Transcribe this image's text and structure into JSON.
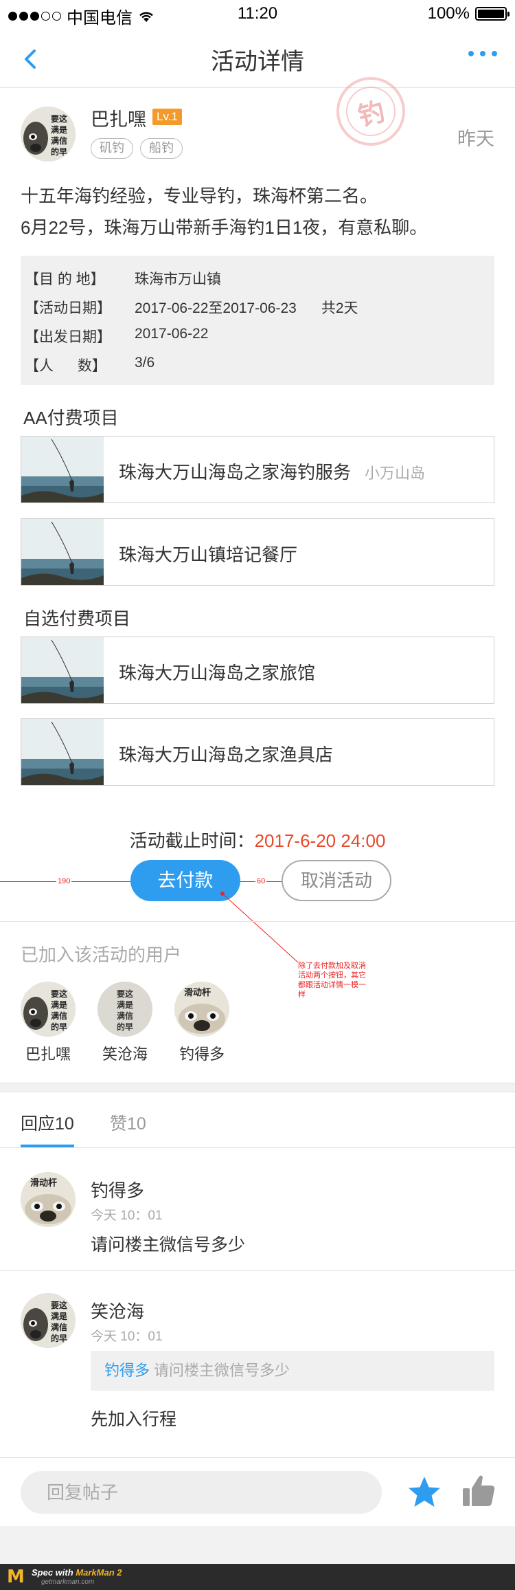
{
  "status_bar": {
    "carrier": "中国电信",
    "time": "11:20",
    "battery": "100%"
  },
  "nav": {
    "title": "活动详情",
    "back_icon": "chevron-left-icon",
    "more_icon": "more-dots-icon"
  },
  "post": {
    "author": "巴扎嘿",
    "level": "Lv.1",
    "tags": [
      "矶钓",
      "船钓"
    ],
    "time": "昨天",
    "seal_text": "钓",
    "avatar_text": "要这满是信的早",
    "text_lines": [
      "十五年海钓经验，专业导钓，珠海杯第二名。",
      "6月22号，珠海万山带新手海钓1日1夜，有意私聊。"
    ]
  },
  "info": {
    "destination_label": "【目 的 地】",
    "destination": "珠海市万山镇",
    "activity_date_label": "【活动日期】",
    "activity_date": "2017-06-22至2017-06-23",
    "activity_days": "共2天",
    "depart_date_label": "【出发日期】",
    "depart_date": "2017-06-22",
    "people_label": "【人      数】",
    "people": "3/6"
  },
  "aa_section": {
    "title": "AA付费项目",
    "items": [
      {
        "name": "珠海大万山海岛之家海钓服务",
        "sub": "小万山岛"
      },
      {
        "name": "珠海大万山镇培记餐厅",
        "sub": ""
      }
    ]
  },
  "optional_section": {
    "title": "自选付费项目",
    "items": [
      {
        "name": "珠海大万山海岛之家旅馆"
      },
      {
        "name": "珠海大万山海岛之家渔具店"
      }
    ]
  },
  "deadline": {
    "label": "活动截止时间：",
    "value": "2017-6-20 24:00"
  },
  "actions": {
    "pay_label": "去付款",
    "cancel_label": "取消活动"
  },
  "spec": {
    "left_gap": "190",
    "button_gap": "60",
    "note": "除了去付款加及取消活动两个按钮，其它都跟活动详情一模一样"
  },
  "joined": {
    "title": "已加入该活动的用户",
    "users": [
      {
        "name": "巴扎嘿",
        "avatar_text": "要这满是信的早"
      },
      {
        "name": "笑沧海",
        "avatar_text": "要这满是信的早"
      },
      {
        "name": "钓得多",
        "avatar_text": "滑动杆"
      }
    ]
  },
  "tabs": {
    "replies": "回应10",
    "likes": "赞10"
  },
  "comments": [
    {
      "user": "钓得多",
      "time": "今天 10：01",
      "text": "请问楼主微信号多少",
      "avatar_text": "滑动杆"
    },
    {
      "user": "笑沧海",
      "time": "今天 10：01",
      "quote_user": "钓得多",
      "quote_text": "请问楼主微信号多少",
      "text": "先加入行程",
      "avatar_text": "要这满是信的早"
    }
  ],
  "reply_bar": {
    "placeholder": "回复帖子",
    "star_icon": "star-icon",
    "like_icon": "thumbs-up-icon"
  },
  "footer": {
    "logo_letter": "M",
    "spec_with": "Spec with",
    "brand": "MarkMan 2",
    "site": "getmarkman.com"
  },
  "colors": {
    "accent": "#2e9df0",
    "deadline": "#e8482a",
    "level_badge": "#f39a2a",
    "spec_red": "#ee2222"
  }
}
